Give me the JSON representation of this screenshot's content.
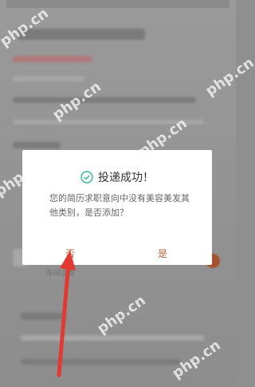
{
  "dialog": {
    "title": "投递成功！",
    "message": "您的简历求职意向中没有美容美发其他类别，是否添加？",
    "no_label": "否",
    "yes_label": "是"
  },
  "background": {
    "small_text": "车间主管"
  },
  "watermark": "php.cn",
  "colors": {
    "accent": "#b0643a",
    "check": "#2fb889",
    "arrow": "#e03a32"
  },
  "icons": [
    "check-circle-icon"
  ]
}
